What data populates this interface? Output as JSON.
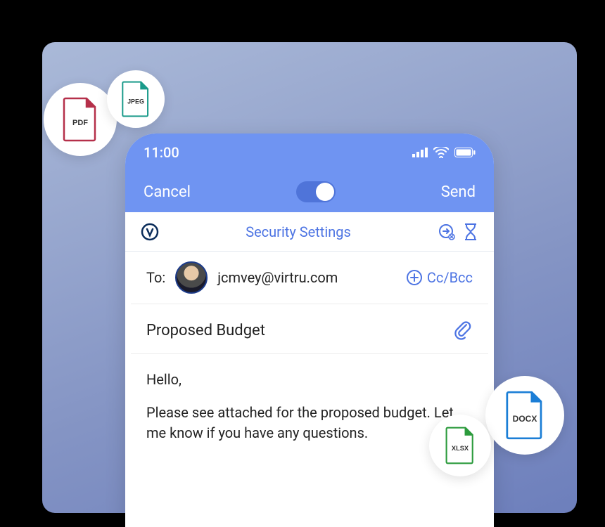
{
  "status": {
    "time": "11:00"
  },
  "nav": {
    "cancel": "Cancel",
    "send": "Send"
  },
  "security": {
    "label": "Security Settings"
  },
  "compose": {
    "to_label": "To:",
    "recipient": "jcmvey@virtru.com",
    "ccbcc": "Cc/Bcc",
    "subject": "Proposed Budget",
    "body_greeting": "Hello,",
    "body_text": "Please see attached for the proposed budget. Let me know if you have any questions."
  },
  "files": {
    "pdf": {
      "label": "PDF",
      "color": "#b5304a"
    },
    "jpeg": {
      "label": "JPEG",
      "color": "#1b9b8b"
    },
    "docx": {
      "label": "DOCX",
      "color": "#1b7ed6"
    },
    "xlsx": {
      "label": "XLSX",
      "color": "#2c9b3d"
    }
  },
  "colors": {
    "accent": "#6f94f2",
    "link": "#4d74e3"
  }
}
